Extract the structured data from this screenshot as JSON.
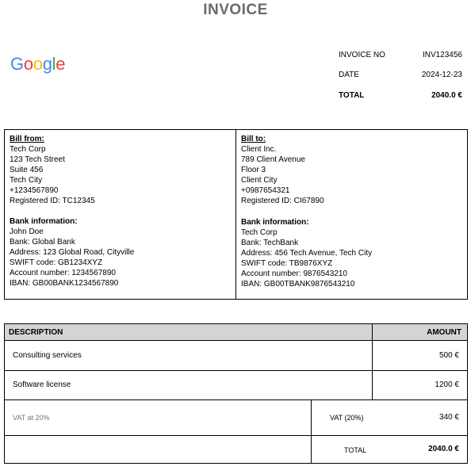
{
  "document": {
    "title": "INVOICE"
  },
  "logo": {
    "letters": [
      {
        "char": "G",
        "color": "#4285F4"
      },
      {
        "char": "o",
        "color": "#EA4335"
      },
      {
        "char": "o",
        "color": "#FBBC05"
      },
      {
        "char": "g",
        "color": "#4285F4"
      },
      {
        "char": "l",
        "color": "#34A853"
      },
      {
        "char": "e",
        "color": "#EA4335"
      }
    ]
  },
  "meta": {
    "invoice_no_label": "INVOICE NO",
    "invoice_no": "INV123456",
    "date_label": "DATE",
    "date": "2024-12-23",
    "total_label": "TOTAL",
    "total": "2040.0 €"
  },
  "bill_from": {
    "heading": "Bill from:",
    "lines": [
      "Tech Corp",
      "123 Tech Street",
      "Suite 456",
      "Tech City",
      "+1234567890",
      "Registered ID: TC12345"
    ],
    "bank_heading": "Bank information:",
    "bank_lines": [
      "John Doe",
      "Bank: Global Bank",
      "Address: 123 Global Road, Cityville",
      "SWIFT code: GB1234XYZ",
      "Account number: 1234567890",
      "IBAN: GB00BANK1234567890"
    ]
  },
  "bill_to": {
    "heading": "Bill to:",
    "lines": [
      "Client Inc.",
      "789 Client Avenue",
      "Floor 3",
      "Client City",
      "+0987654321",
      "Registered ID: CI67890"
    ],
    "bank_heading": "Bank information:",
    "bank_lines": [
      "Tech Corp",
      "Bank: TechBank",
      "Address: 456 Tech Avenue, Tech City",
      "SWIFT code: TB9876XYZ",
      "Account number: 9876543210",
      "IBAN: GB00TBANK9876543210"
    ]
  },
  "items": {
    "col_description": "DESCRIPTION",
    "col_amount": "AMOUNT",
    "rows": [
      {
        "description": "Consulting services",
        "amount": "500 €"
      },
      {
        "description": "Software license",
        "amount": "1200 €"
      }
    ],
    "vat_note": "VAT at 20%",
    "vat_label": "VAT  (20%)",
    "vat_amount": "340 €",
    "total_label": "TOTAL",
    "total_amount": "2040.0 €"
  }
}
